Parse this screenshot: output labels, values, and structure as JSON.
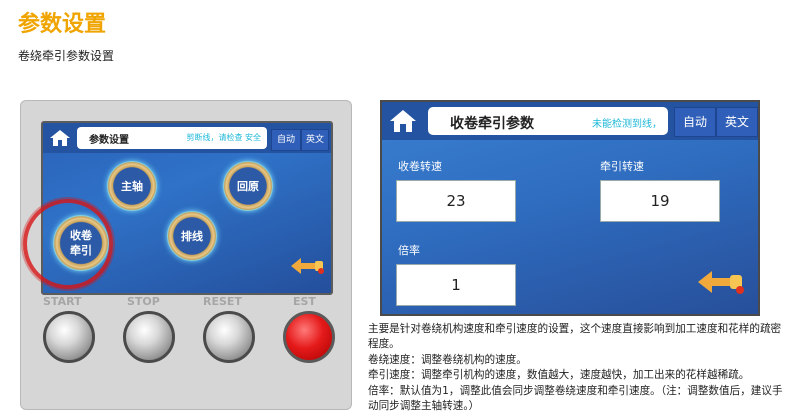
{
  "page": {
    "title": "参数设置",
    "subtitle": "卷绕牵引参数设置"
  },
  "device": {
    "screen": {
      "title": "参数设置",
      "status": "剪断线，请检查 安全",
      "auto_label": "自动",
      "lang_label": "英文",
      "buttons": {
        "main": "主轴",
        "home": "回原",
        "wind_line1": "收卷",
        "wind_line2": "牵引",
        "row": "排线"
      }
    },
    "hardware_buttons": [
      "START",
      "STOP",
      "RESET",
      "EST"
    ]
  },
  "screen": {
    "title": "收卷牵引参数",
    "status": "未能检测到线，",
    "auto_label": "自动",
    "lang_label": "英文",
    "fields": {
      "wind_speed": {
        "label": "收卷转速",
        "value": "23"
      },
      "pull_speed": {
        "label": "牵引转速",
        "value": "19"
      },
      "ratio": {
        "label": "倍率",
        "value": "1"
      }
    }
  },
  "description": [
    "主要是针对卷绕机构速度和牵引速度的设置，这个速度直接影响到加工速度和花样的疏密程度。",
    "卷绕速度：调整卷绕机构的速度。",
    "牵引速度：调整牵引机构的速度，数值越大，速度越快，加工出来的花样越稀疏。",
    "倍率：默认值为1，调整此值会同步调整卷绕速度和牵引速度。（注：调整数值后，建议手动同步调整主轴转速。）"
  ],
  "colors": {
    "title": "#f0a400",
    "screen_bg": "#2f6dc0",
    "status_text": "#1db8d8",
    "highlight": "#d71414"
  }
}
